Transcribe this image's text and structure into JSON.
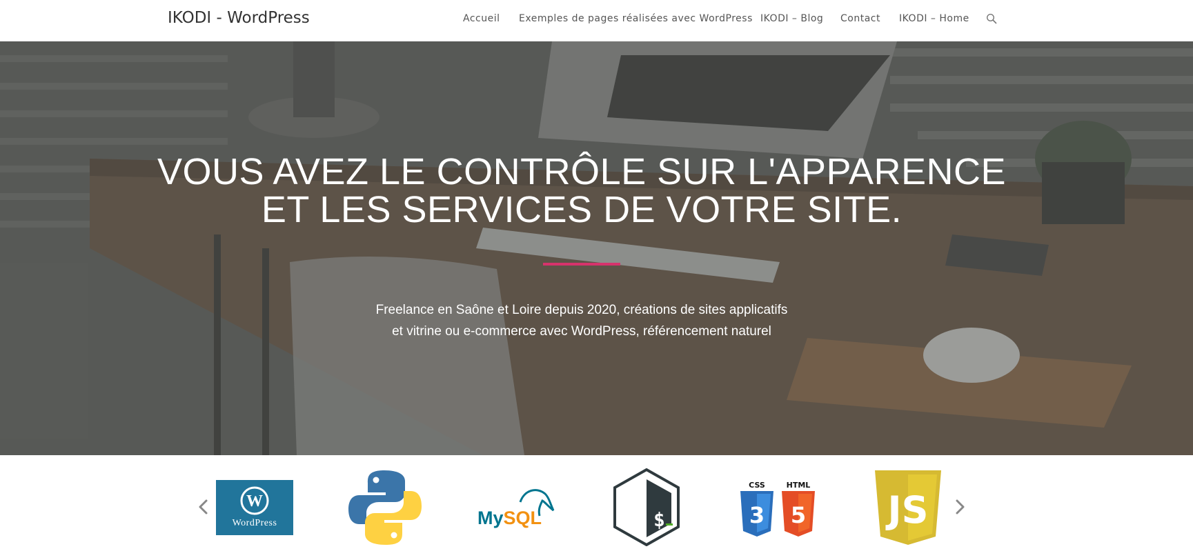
{
  "header": {
    "site_title": "IKODI - WordPress",
    "nav": [
      {
        "label": "Accueil"
      },
      {
        "label": "Exemples de pages réalisées avec WordPress"
      },
      {
        "label": "IKODI – Blog"
      },
      {
        "label": "Contact"
      },
      {
        "label": "IKODI – Home"
      }
    ],
    "search_icon": "search-icon"
  },
  "hero": {
    "title_line1": "VOUS AVEZ LE CONTRÔLE SUR L'APPARENCE",
    "title_line2": "ET LES SERVICES DE VOTRE SITE.",
    "subtitle_line1": "Freelance en Saône et Loire depuis 2020, créations de sites applicatifs",
    "subtitle_line2": "et vitrine ou e-commerce avec WordPress, référencement naturel",
    "accent_color": "#d6336c"
  },
  "carousel": {
    "prev_icon": "chevron-left-icon",
    "next_icon": "chevron-right-icon",
    "logos": [
      {
        "name": "wordpress-logo",
        "text": "WordPress"
      },
      {
        "name": "python-logo"
      },
      {
        "name": "mysql-logo",
        "text": "MySQL"
      },
      {
        "name": "bash-logo",
        "text": "$_"
      },
      {
        "name": "css3-html5-logo",
        "text_css": "CSS",
        "text_html": "HTML",
        "digit_css": "3",
        "digit_html": "5"
      },
      {
        "name": "javascript-logo",
        "text": "JS"
      }
    ]
  },
  "colors": {
    "wordpress_blue": "#21759b",
    "python_blue": "#3b75a9",
    "python_yellow": "#fed142",
    "mysql_blue": "#00758f",
    "mysql_orange": "#f29111",
    "css_blue": "#2a6ebb",
    "html_orange": "#e44d26",
    "js_yellow": "#d6ba32"
  }
}
